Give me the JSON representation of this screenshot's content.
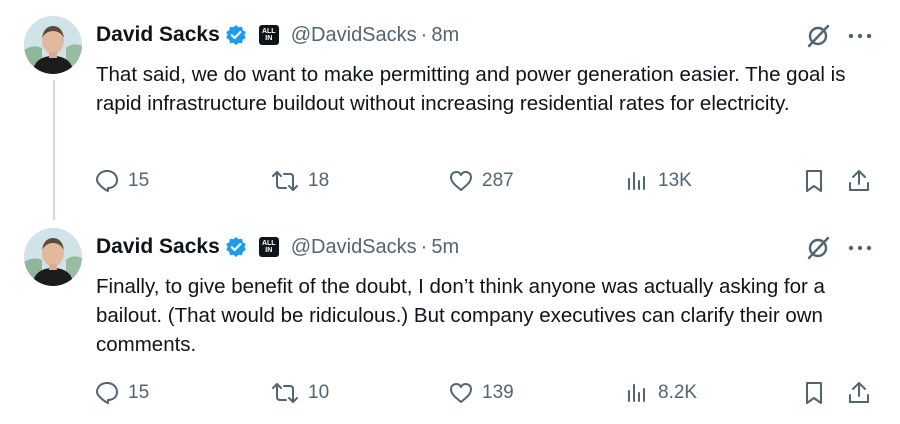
{
  "tweets": [
    {
      "author": "David Sacks",
      "handle": "@DavidSacks",
      "separator": "·",
      "time": "8m",
      "badge_text": "ALL IN",
      "text": "That said, we do want to make permitting and power generation easier. The goal is rapid infrastructure buildout without increasing residential rates for electricity.",
      "replies": "15",
      "reposts": "18",
      "likes": "287",
      "views": "13K"
    },
    {
      "author": "David Sacks",
      "handle": "@DavidSacks",
      "separator": "·",
      "time": "5m",
      "badge_text": "ALL IN",
      "text": "Finally, to give benefit of the doubt, I don’t think anyone was actually asking for a bailout. (That would be ridiculous.) But company executives can clarify their own comments.",
      "replies": "15",
      "reposts": "10",
      "likes": "139",
      "views": "8.2K"
    }
  ],
  "colors": {
    "verified": "#1d9bf0",
    "secondary_text": "#536471",
    "primary_text": "#0f1419",
    "thread_line": "#cfd9de"
  },
  "icons": [
    "verified-badge-icon",
    "all-in-badge-icon",
    "grok-icon",
    "more-icon",
    "reply-icon",
    "repost-icon",
    "like-icon",
    "views-icon",
    "bookmark-icon",
    "share-icon"
  ]
}
